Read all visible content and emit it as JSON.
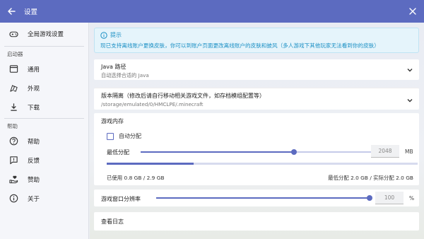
{
  "topbar": {
    "title": "设置"
  },
  "sidebar": {
    "global_settings": "全局游戏设置",
    "section_launcher": "启动器",
    "section_help": "帮助",
    "items": [
      {
        "label": "通用",
        "icon": "window-icon"
      },
      {
        "label": "外观",
        "icon": "palette-icon"
      },
      {
        "label": "下载",
        "icon": "download-icon"
      }
    ],
    "help_items": [
      {
        "label": "帮助",
        "icon": "help-circle-icon"
      },
      {
        "label": "反馈",
        "icon": "feedback-icon"
      },
      {
        "label": "赞助",
        "icon": "sponsor-icon"
      },
      {
        "label": "关于",
        "icon": "info-icon"
      }
    ]
  },
  "hint": {
    "title": "提示",
    "text": "现已支持离线账户更换皮肤，你可以到账户页面更改离线账户的皮肤和披风（多人游戏下其他玩家无法看到你的皮肤）"
  },
  "java": {
    "title": "Java 路径",
    "subtitle": "自动选择合适的 Java"
  },
  "storage": {
    "title": "版本隔离（修改后请自行移动相关游戏文件，如存档模组配置等）",
    "path": "/storage/emulated/0/HMCLPE/.minecraft"
  },
  "memory": {
    "title": "游戏内存",
    "auto_label": "自动分配",
    "auto_checked": false,
    "min_label": "最低分配",
    "min_value": "2048",
    "min_value_mb": 2048,
    "min_unit": "MB",
    "usage_fraction": 0.28,
    "used_text": "已使用 0.8 GB / 2.9 GB",
    "alloc_text": "最低分配 2.0 GB / 实际分配 2.0 GB"
  },
  "resolution": {
    "label": "游戏窗口分辨率",
    "value": "100",
    "value_percent": 100,
    "unit": "%"
  },
  "log": {
    "label": "查看日志"
  },
  "colors": {
    "accent": "#5c6bc0",
    "hint_text": "#1a8fc4",
    "hint_bg": "#e5f4fb"
  }
}
